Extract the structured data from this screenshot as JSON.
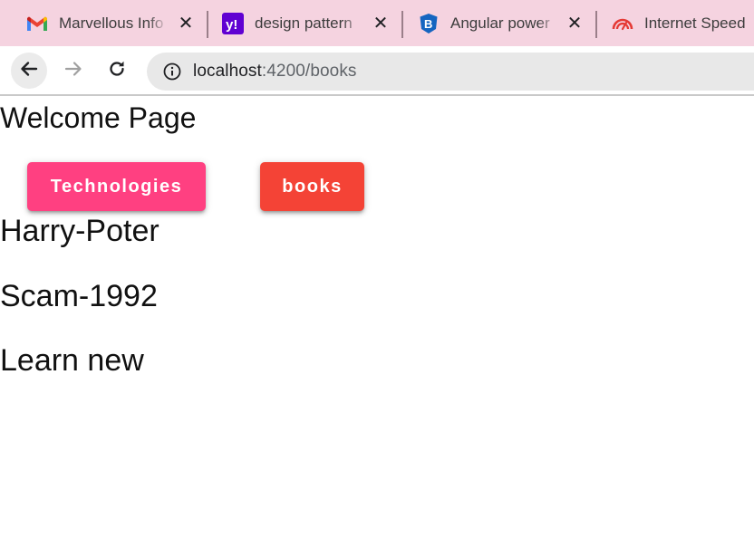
{
  "browser": {
    "tabs": [
      {
        "title": "Marvellous Info",
        "icon": "gmail-icon"
      },
      {
        "title": "design pattern",
        "icon": "yahoo-icon"
      },
      {
        "title": "Angular power",
        "icon": "bootstrap-icon"
      },
      {
        "title": "Internet Speed",
        "icon": "speedometer-icon"
      }
    ],
    "close_glyph": "✕",
    "address": {
      "host": "localhost",
      "path": ":4200/books"
    }
  },
  "page": {
    "heading": "Welcome Page",
    "buttons": {
      "technologies": "Technologies",
      "books": "books"
    },
    "books": [
      "Harry-Poter",
      "Scam-1992",
      "Learn new"
    ]
  },
  "colors": {
    "tab_strip": "#f5d3e0",
    "technologies_button": "#ff4081",
    "books_button": "#f44336"
  }
}
